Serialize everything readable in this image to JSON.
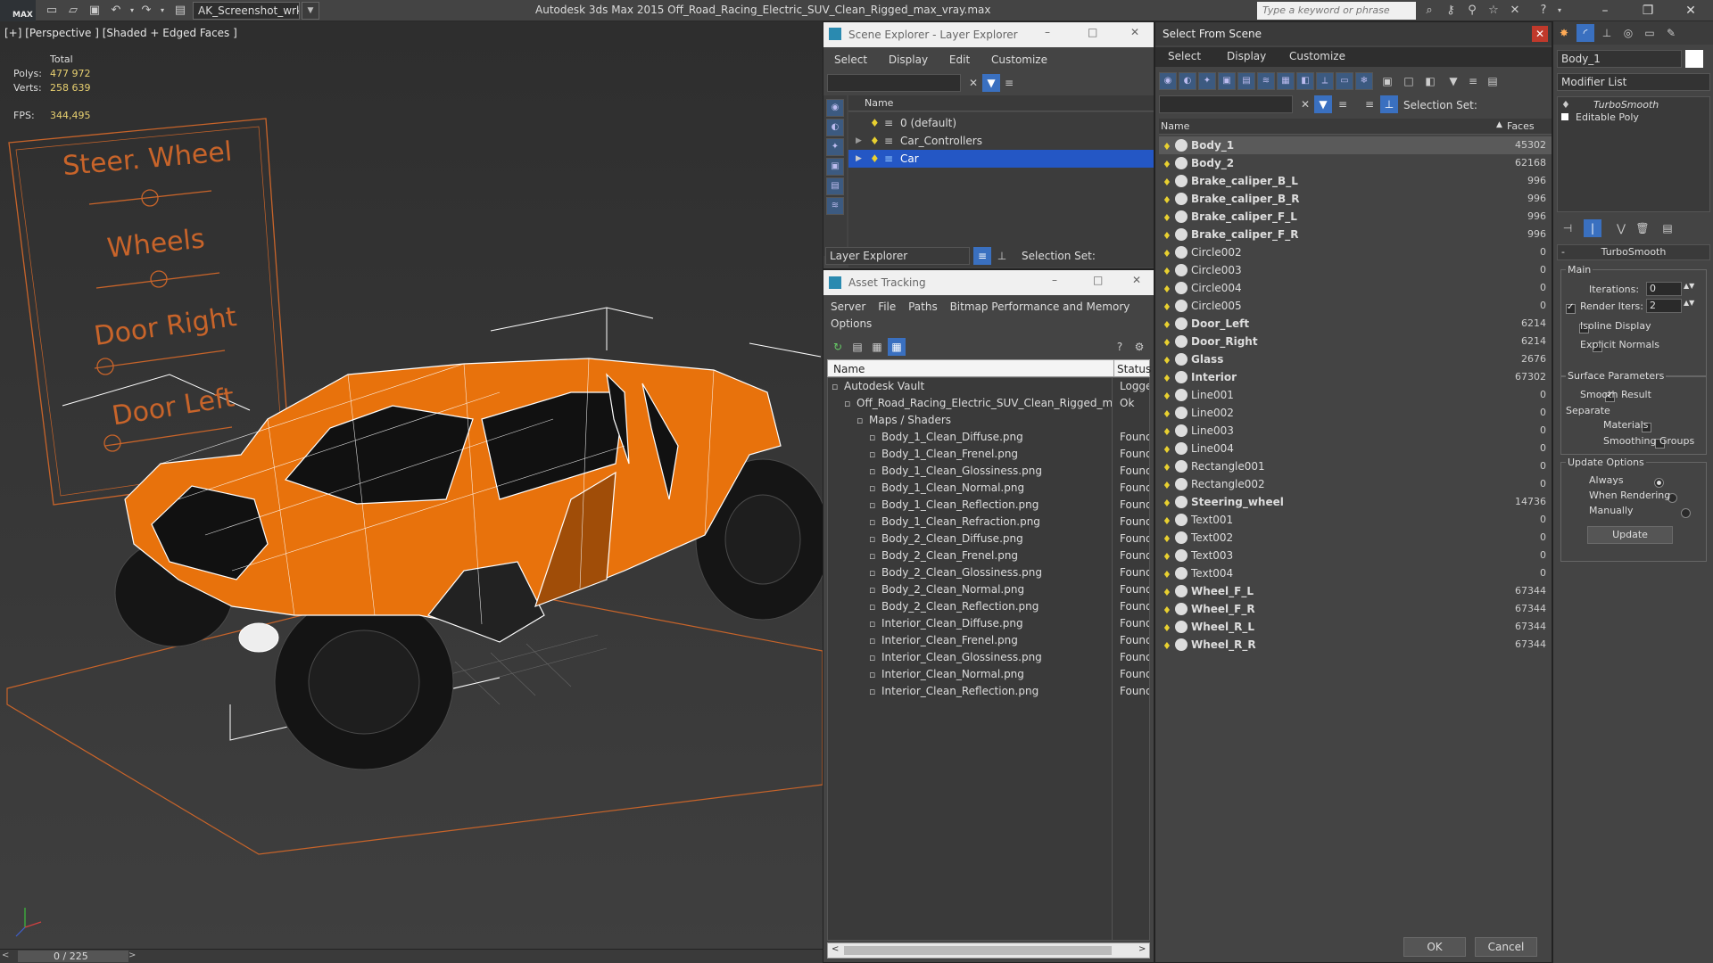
{
  "titlebar": {
    "logo": "MAX",
    "workspace": "AK_Screenshot_wrksp",
    "app_title": "Autodesk 3ds Max  2015    Off_Road_Racing_Electric_SUV_Clean_Rigged_max_vray.max",
    "search_placeholder": "Type a keyword or phrase"
  },
  "viewport": {
    "label": "[+] [Perspective ] [Shaded + Edged Faces ]",
    "stats": {
      "total_label": "Total",
      "polys_label": "Polys:",
      "polys_value": "477 972",
      "verts_label": "Verts:",
      "verts_value": "258 639",
      "fps_label": "FPS:",
      "fps_value": "344,495"
    },
    "controls": [
      "Steer. Wheel",
      "Wheels",
      "Door Right",
      "Door Left"
    ],
    "timeline": "0 / 225"
  },
  "scene_explorer": {
    "title": "Scene Explorer - Layer Explorer",
    "menu": [
      "Select",
      "Display",
      "Edit",
      "Customize"
    ],
    "column": "Name",
    "layers": [
      {
        "name": "0 (default)",
        "selected": false
      },
      {
        "name": "Car_Controllers",
        "selected": false
      },
      {
        "name": "Car",
        "selected": true
      }
    ],
    "footer_dropdown": "Layer Explorer",
    "selection_set_label": "Selection Set:"
  },
  "asset_tracking": {
    "title": "Asset Tracking",
    "menu": [
      "Server",
      "File",
      "Paths",
      "Bitmap Performance and Memory",
      "Options"
    ],
    "col_name": "Name",
    "col_status": "Status",
    "rows": [
      {
        "name": "Autodesk Vault",
        "status": "Logge",
        "indent": 0
      },
      {
        "name": "Off_Road_Racing_Electric_SUV_Clean_Rigged_m...",
        "status": "Ok",
        "indent": 1
      },
      {
        "name": "Maps / Shaders",
        "status": "",
        "indent": 2
      },
      {
        "name": "Body_1_Clean_Diffuse.png",
        "status": "Found",
        "indent": 3
      },
      {
        "name": "Body_1_Clean_Frenel.png",
        "status": "Found",
        "indent": 3
      },
      {
        "name": "Body_1_Clean_Glossiness.png",
        "status": "Found",
        "indent": 3
      },
      {
        "name": "Body_1_Clean_Normal.png",
        "status": "Found",
        "indent": 3
      },
      {
        "name": "Body_1_Clean_Reflection.png",
        "status": "Found",
        "indent": 3
      },
      {
        "name": "Body_1_Clean_Refraction.png",
        "status": "Found",
        "indent": 3
      },
      {
        "name": "Body_2_Clean_Diffuse.png",
        "status": "Found",
        "indent": 3
      },
      {
        "name": "Body_2_Clean_Frenel.png",
        "status": "Found",
        "indent": 3
      },
      {
        "name": "Body_2_Clean_Glossiness.png",
        "status": "Found",
        "indent": 3
      },
      {
        "name": "Body_2_Clean_Normal.png",
        "status": "Found",
        "indent": 3
      },
      {
        "name": "Body_2_Clean_Reflection.png",
        "status": "Found",
        "indent": 3
      },
      {
        "name": "Interior_Clean_Diffuse.png",
        "status": "Found",
        "indent": 3
      },
      {
        "name": "Interior_Clean_Frenel.png",
        "status": "Found",
        "indent": 3
      },
      {
        "name": "Interior_Clean_Glossiness.png",
        "status": "Found",
        "indent": 3
      },
      {
        "name": "Interior_Clean_Normal.png",
        "status": "Found",
        "indent": 3
      },
      {
        "name": "Interior_Clean_Reflection.png",
        "status": "Found",
        "indent": 3
      }
    ]
  },
  "select_from_scene": {
    "title": "Select From Scene",
    "menu": [
      "Select",
      "Display",
      "Customize"
    ],
    "selection_set_label": "Selection Set:",
    "col_name": "Name",
    "col_faces": "Faces",
    "objects": [
      {
        "name": "Body_1",
        "faces": "45302",
        "bold": true,
        "selected": true
      },
      {
        "name": "Body_2",
        "faces": "62168",
        "bold": true
      },
      {
        "name": "Brake_caliper_B_L",
        "faces": "996",
        "bold": true
      },
      {
        "name": "Brake_caliper_B_R",
        "faces": "996",
        "bold": true
      },
      {
        "name": "Brake_caliper_F_L",
        "faces": "996",
        "bold": true
      },
      {
        "name": "Brake_caliper_F_R",
        "faces": "996",
        "bold": true
      },
      {
        "name": "Circle002",
        "faces": "0",
        "bold": false
      },
      {
        "name": "Circle003",
        "faces": "0",
        "bold": false
      },
      {
        "name": "Circle004",
        "faces": "0",
        "bold": false
      },
      {
        "name": "Circle005",
        "faces": "0",
        "bold": false
      },
      {
        "name": "Door_Left",
        "faces": "6214",
        "bold": true
      },
      {
        "name": "Door_Right",
        "faces": "6214",
        "bold": true
      },
      {
        "name": "Glass",
        "faces": "2676",
        "bold": true
      },
      {
        "name": "Interior",
        "faces": "67302",
        "bold": true
      },
      {
        "name": "Line001",
        "faces": "0",
        "bold": false
      },
      {
        "name": "Line002",
        "faces": "0",
        "bold": false
      },
      {
        "name": "Line003",
        "faces": "0",
        "bold": false
      },
      {
        "name": "Line004",
        "faces": "0",
        "bold": false
      },
      {
        "name": "Rectangle001",
        "faces": "0",
        "bold": false
      },
      {
        "name": "Rectangle002",
        "faces": "0",
        "bold": false
      },
      {
        "name": "Steering_wheel",
        "faces": "14736",
        "bold": true
      },
      {
        "name": "Text001",
        "faces": "0",
        "bold": false
      },
      {
        "name": "Text002",
        "faces": "0",
        "bold": false
      },
      {
        "name": "Text003",
        "faces": "0",
        "bold": false
      },
      {
        "name": "Text004",
        "faces": "0",
        "bold": false
      },
      {
        "name": "Wheel_F_L",
        "faces": "67344",
        "bold": true
      },
      {
        "name": "Wheel_F_R",
        "faces": "67344",
        "bold": true
      },
      {
        "name": "Wheel_R_L",
        "faces": "67344",
        "bold": true
      },
      {
        "name": "Wheel_R_R",
        "faces": "67344",
        "bold": true
      }
    ],
    "ok": "OK",
    "cancel": "Cancel"
  },
  "modify_panel": {
    "object_name": "Body_1",
    "modifier_list": "Modifier List",
    "stack": [
      "TurboSmooth",
      "Editable Poly"
    ],
    "rollout_title": "TurboSmooth",
    "main_group": "Main",
    "iterations_label": "Iterations:",
    "iterations_value": "0",
    "render_iters_label": "Render Iters:",
    "render_iters_value": "2",
    "isoline_label": "Isoline Display",
    "explicit_label": "Explicit Normals",
    "surface_group": "Surface Parameters",
    "smooth_label": "Smooth Result",
    "separate_label": "Separate",
    "materials_label": "Materials",
    "smoothing_groups_label": "Smoothing Groups",
    "update_group": "Update Options",
    "always_label": "Always",
    "when_rendering_label": "When Rendering",
    "manually_label": "Manually",
    "update_button": "Update"
  },
  "colors": {
    "accent_select": "#2457c5",
    "car_orange": "#e8720c",
    "wire": "#ffffff",
    "helper_orange": "#c8642a",
    "bulb": "#e8d030"
  }
}
